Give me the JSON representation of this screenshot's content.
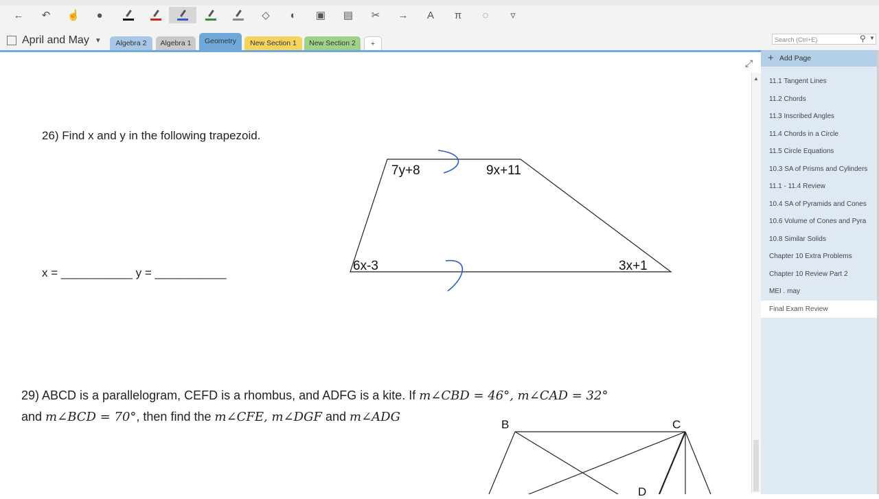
{
  "toolbar": {
    "buttons": [
      {
        "name": "back-icon",
        "glyph": "←"
      },
      {
        "name": "undo-icon",
        "glyph": "↶"
      },
      {
        "name": "touch-icon",
        "glyph": "☝"
      },
      {
        "name": "lasso-icon",
        "glyph": "●"
      },
      {
        "name": "pen-black-icon",
        "glyph": ""
      },
      {
        "name": "pen-red-icon",
        "glyph": ""
      },
      {
        "name": "pen-blue-icon",
        "glyph": ""
      },
      {
        "name": "pen-green-icon",
        "glyph": ""
      },
      {
        "name": "pen-gray-icon",
        "glyph": ""
      },
      {
        "name": "eraser-icon",
        "glyph": "◇"
      },
      {
        "name": "palette-icon",
        "glyph": "◐"
      },
      {
        "name": "insert-space-icon",
        "glyph": "▣"
      },
      {
        "name": "paste-icon",
        "glyph": "▤"
      },
      {
        "name": "cut-icon",
        "glyph": "✂"
      },
      {
        "name": "forward-icon",
        "glyph": "→"
      },
      {
        "name": "ink-to-text-icon",
        "glyph": "A"
      },
      {
        "name": "ink-to-math-icon",
        "glyph": "π"
      },
      {
        "name": "lasso-select-icon",
        "glyph": "◌"
      },
      {
        "name": "more-icon",
        "glyph": "▿"
      }
    ],
    "pen_colors": [
      "#111111",
      "#e01b24",
      "#2d5fbf",
      "#2e8b3e",
      "#888888"
    ]
  },
  "notebook": {
    "name": "April and May"
  },
  "tabs": [
    {
      "label": "Algebra 2",
      "color": "#a8c6e6"
    },
    {
      "label": "Algebra 1",
      "color": "#c9c9c9"
    },
    {
      "label": "Geometry",
      "color": "#6fa9d9"
    },
    {
      "label": "New Section 1",
      "color": "#f4d35e"
    },
    {
      "label": "New Section 2",
      "color": "#9ed28a"
    },
    {
      "label": "+",
      "color": "#ffffff"
    }
  ],
  "search": {
    "placeholder": "Search (Ctrl+E)"
  },
  "pages": {
    "add_label": "Add Page",
    "items": [
      "11.1 Tangent Lines",
      "11.2 Chords",
      "11.3 Inscribed Angles",
      "11.4 Chords in a Circle",
      "11.5 Circle Equations",
      "10.3 SA of Prisms and Cylinders",
      "11.1 - 11.4 Review",
      "10.4 SA of Pyramids and Cones",
      "10.6 Volume of Cones and Pyra",
      "10.8 Similar Solids",
      "Chapter 10 Extra Problems",
      "Chapter 10 Review Part 2",
      "MEI . may",
      "Final Exam Review"
    ],
    "selected_index": 13
  },
  "problem26": {
    "question": "26)  Find x and y in the following trapezoid.",
    "answer_line": "x = ___________ y = ___________",
    "labels": {
      "top_left": "7y+8",
      "top_right": "9x+11",
      "bottom_left": "6x-3",
      "bottom_right": "3x+1"
    }
  },
  "problem29": {
    "line1_text": "29)  ABCD is a parallelogram, CEFD is a rhombus, and ADFG is a kite.  If ",
    "line1_math": "m∠CBD = 46°, m∠CAD = 32°",
    "line2_and": "and ",
    "line2_math1": "m∠BCD = 70°",
    "line2_mid": ", then find the ",
    "line2_math2": "m∠CFE, m∠DGF",
    "line2_and2": " and ",
    "line2_math3": "m∠ADG",
    "figure_labels": {
      "b": "B",
      "c": "C",
      "d": "D"
    }
  }
}
